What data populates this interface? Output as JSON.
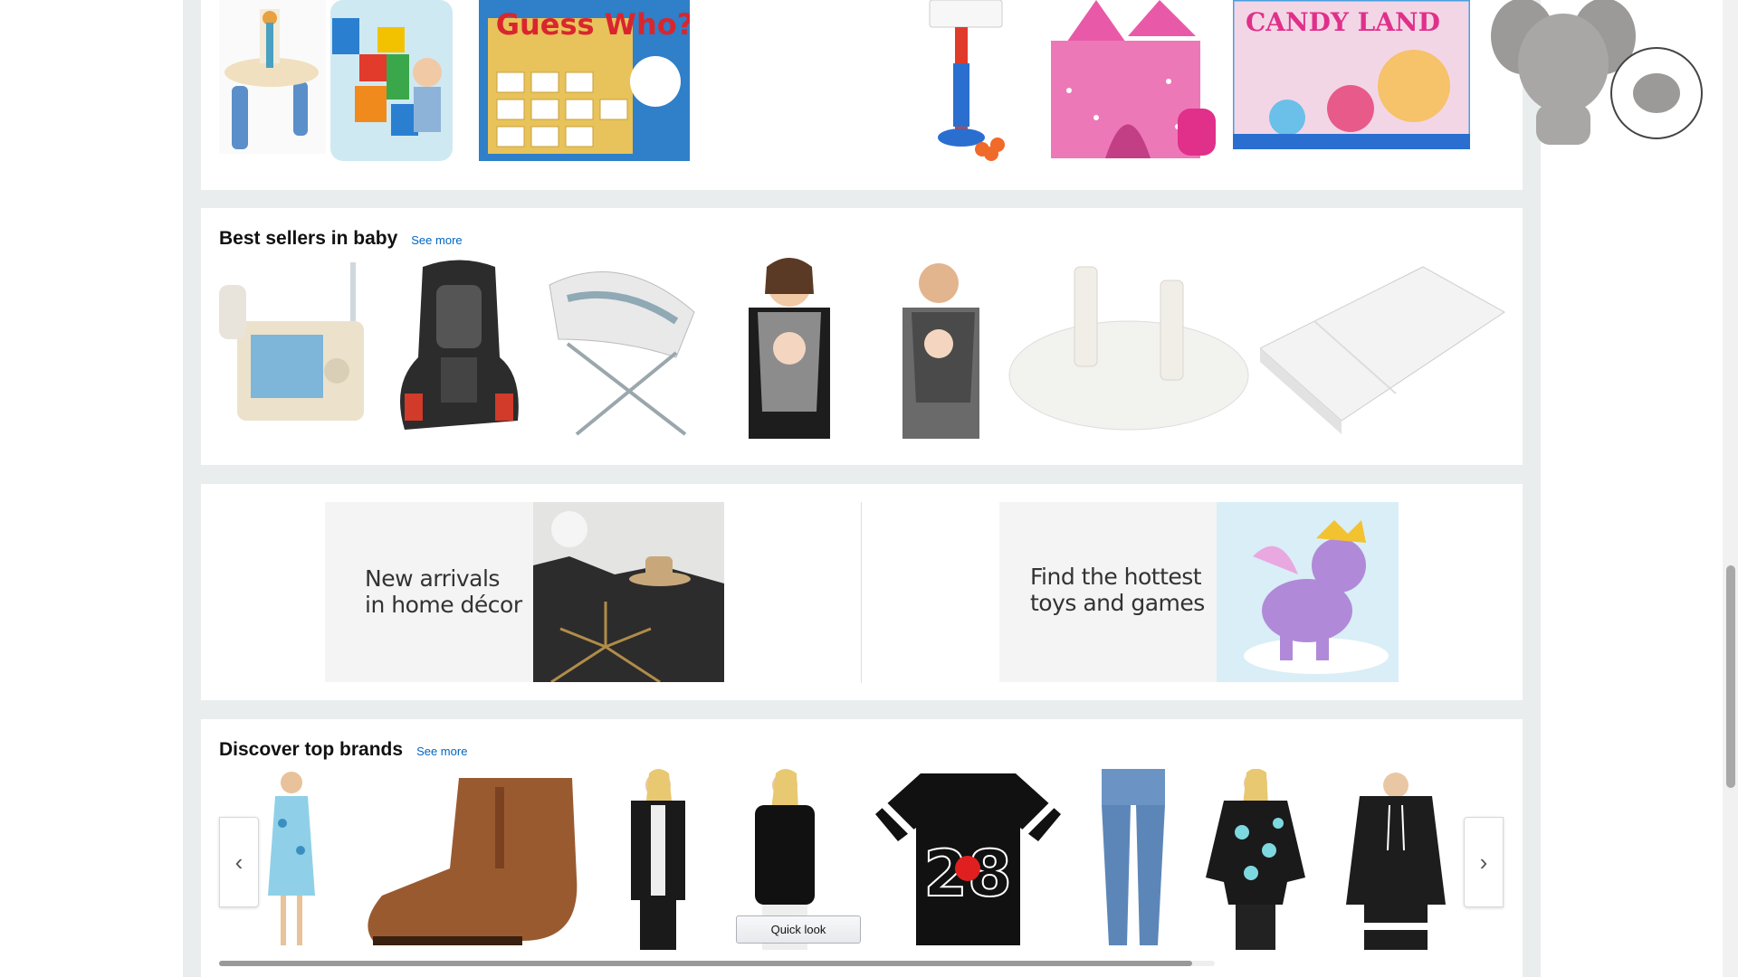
{
  "toys_row": {
    "products": [
      {
        "icon": "water-table-toy"
      },
      {
        "icon": "mega-bloks-bag"
      },
      {
        "icon": "guess-who-game",
        "box_text": "Guess Who?"
      },
      {
        "icon": "basketball-hoop-toy"
      },
      {
        "icon": "pink-castle-tent"
      },
      {
        "icon": "candy-land-game",
        "box_text": "CANDY LAND"
      },
      {
        "icon": "plush-elephant-toy"
      }
    ]
  },
  "baby_section": {
    "title": "Best sellers in baby",
    "see_more": "See more",
    "products": [
      {
        "icon": "video-baby-monitor"
      },
      {
        "icon": "car-seat"
      },
      {
        "icon": "baby-rocker"
      },
      {
        "icon": "baby-wrap-carrier-woman"
      },
      {
        "icon": "baby-wrap-carrier-man"
      },
      {
        "icon": "outlet-plug-cover"
      },
      {
        "icon": "changing-pad"
      }
    ]
  },
  "promo_section": {
    "left": {
      "line1": "New arrivals",
      "line2": "in home décor",
      "icon": "home-decor-image"
    },
    "right": {
      "line1": "Find the hottest",
      "line2": "toys and games",
      "icon": "pony-toy-image"
    }
  },
  "brands_section": {
    "title": "Discover top brands",
    "see_more": "See more",
    "quick_look": "Quick look",
    "prev_label": "‹",
    "next_label": "›",
    "products": [
      {
        "icon": "floral-dress"
      },
      {
        "icon": "ankle-boot"
      },
      {
        "icon": "cardigan-outfit"
      },
      {
        "icon": "black-top"
      },
      {
        "icon": "minnie-mouse-tee",
        "print": "28"
      },
      {
        "icon": "blue-jeans"
      },
      {
        "icon": "floral-blouse"
      },
      {
        "icon": "black-hoodie"
      }
    ]
  },
  "colors": {
    "link": "#0066c0",
    "page_bg": "#eaeded",
    "card_bg": "#ffffff"
  }
}
